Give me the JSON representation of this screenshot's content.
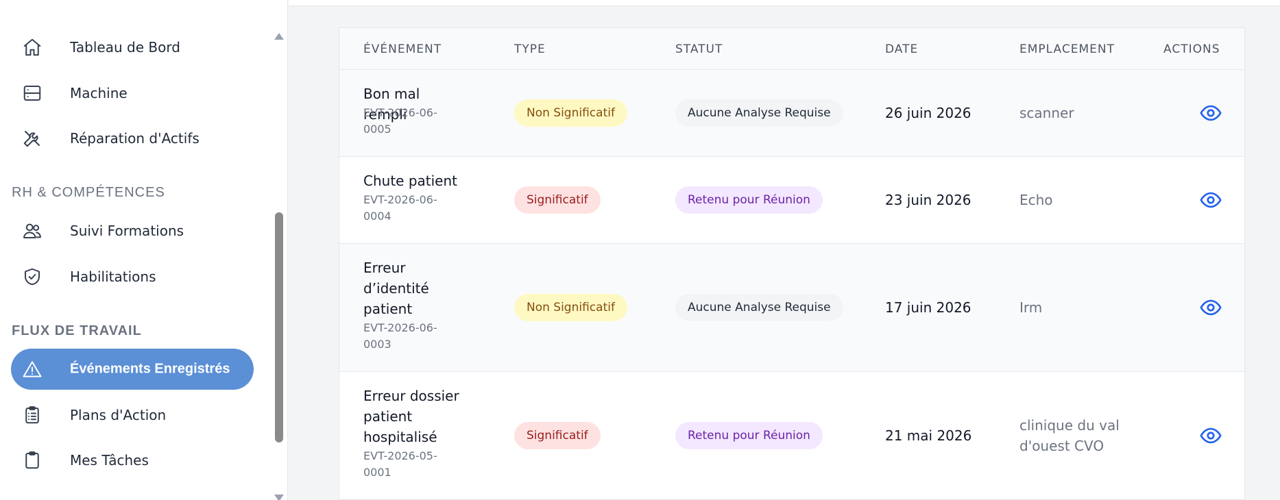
{
  "sidebar": {
    "items_top": [
      {
        "label": "Tableau de Bord",
        "icon": "home-icon"
      },
      {
        "label": "Machine",
        "icon": "server-icon"
      },
      {
        "label": "Réparation d'Actifs",
        "icon": "tools-icon"
      }
    ],
    "section_rh": "RH & COMPÉTENCES",
    "items_rh": [
      {
        "label": "Suivi Formations",
        "icon": "users-icon"
      },
      {
        "label": "Habilitations",
        "icon": "shield-check-icon"
      }
    ],
    "section_flux": "FLUX DE TRAVAIL",
    "items_flux": [
      {
        "label": "Événements Enregistrés",
        "icon": "warning-icon",
        "active": true
      },
      {
        "label": "Plans d'Action",
        "icon": "clipboard-list-icon"
      },
      {
        "label": "Mes Tâches",
        "icon": "clipboard-icon"
      }
    ]
  },
  "table": {
    "headers": [
      "ÉVÉNEMENT",
      "TYPE",
      "STATUT",
      "DATE",
      "EMPLACEMENT",
      "ACTIONS"
    ],
    "rows": [
      {
        "title": "Bon mal rempli",
        "code": "EVT-2026-06-0005",
        "type": "Non Significatif",
        "status": "Aucune Analyse Requise",
        "date": "26 juin 2026",
        "location": "scanner"
      },
      {
        "title": "Chute patient",
        "code": "EVT-2026-06-0004",
        "type": "Significatif",
        "status": "Retenu pour Réunion",
        "date": "23 juin 2026",
        "location": "Echo"
      },
      {
        "title": "Erreur d’identité patient",
        "code": "EVT-2026-06-0003",
        "type": "Non Significatif",
        "status": "Aucune Analyse Requise",
        "date": "17 juin 2026",
        "location": "Irm"
      },
      {
        "title": "Erreur dossier patient hospitalisé",
        "code": "EVT-2026-05-0001",
        "type": "Significatif",
        "status": "Retenu pour Réunion",
        "date": "21 mai 2026",
        "location": "clinique du val d'ouest CVO"
      }
    ]
  },
  "colors": {
    "active_nav": "#5b8fd6",
    "action_icon": "#2563eb",
    "badge_non_significatif": "#fef9c3",
    "badge_significatif": "#fee2e2",
    "badge_aucune_analyse": "#f3f4f6",
    "badge_retenu": "#f3e8ff"
  }
}
